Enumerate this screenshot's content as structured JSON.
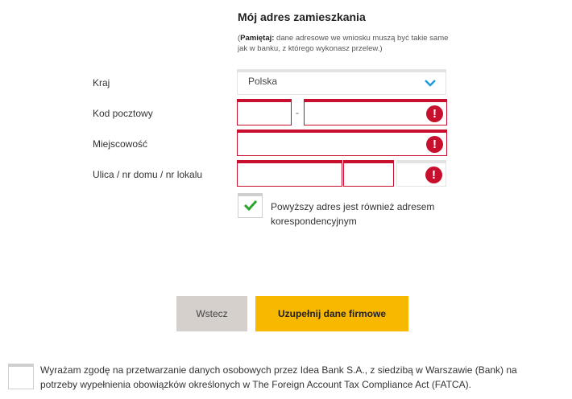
{
  "section": {
    "title": "Mój adres zamieszkania",
    "note_bold": "Pamiętaj:",
    "note_open": "(",
    "note_text": " dane adresowe we wniosku muszą być takie same jak w banku, z którego wykonasz przelew.)"
  },
  "fields": {
    "country_label": "Kraj",
    "country_value": "Polska",
    "postal_label": "Kod pocztowy",
    "postal_separator": "-",
    "city_label": "Miejscowość",
    "street_label": "Ulica / nr domu / nr lokalu"
  },
  "correspondence": {
    "checked": true,
    "label": "Powyższy adres jest również adresem korespondencyjnym"
  },
  "buttons": {
    "back": "Wstecz",
    "next": "Uzupełnij dane firmowe"
  },
  "consent": {
    "checked": false,
    "text": "Wyrażam zgodę na przetwarzanie danych osobowych przez Idea Bank S.A., z siedzibą w Warszawie (Bank) na potrzeby wypełnienia obowiązków określonych w The Foreign Account Tax Compliance Act (FATCA)."
  },
  "icons": {
    "chevron": "chevron-down-icon",
    "error": "error-exclamation-icon",
    "check": "checkmark-icon"
  },
  "colors": {
    "error": "#c8102e",
    "accent_yellow": "#f8b800",
    "check_green": "#2aa52a",
    "chevron_blue": "#1e9ad6",
    "back_button": "#d5d0cb"
  }
}
